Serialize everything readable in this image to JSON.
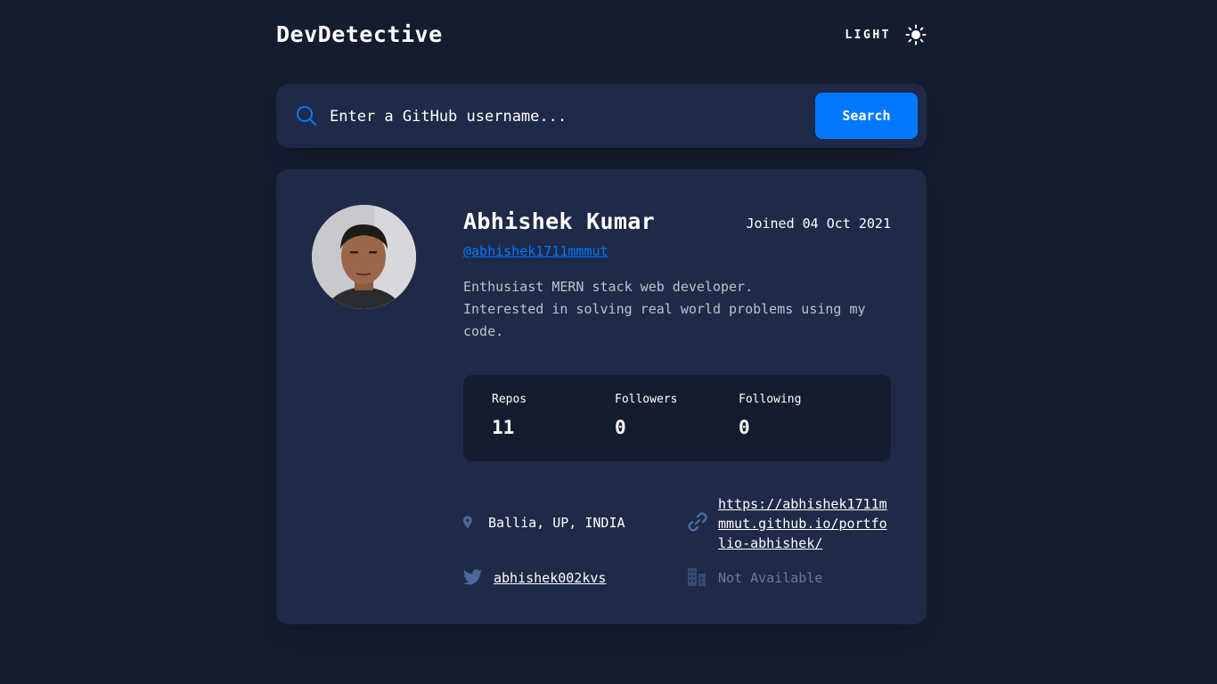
{
  "app": {
    "title": "DevDetective",
    "theme_label": "LIGHT",
    "theme_icon": "sun-icon"
  },
  "search": {
    "placeholder": "Enter a GitHub username...",
    "button_label": "Search",
    "icon": "search-icon"
  },
  "profile": {
    "name": "Abhishek Kumar",
    "joined": "Joined 04 Oct 2021",
    "username": "@abhishek1711mmmut",
    "bio_lines": [
      "Enthusiast MERN stack web developer.",
      "Interested in solving real world problems using my",
      "code."
    ],
    "stats": [
      {
        "label": "Repos",
        "value": "11"
      },
      {
        "label": "Followers",
        "value": "0"
      },
      {
        "label": "Following",
        "value": "0"
      }
    ],
    "links": {
      "location": {
        "icon": "location-pin-icon",
        "text": "Ballia, UP, INDIA"
      },
      "website": {
        "icon": "link-icon",
        "text": "https://abhishek1711mmmut.github.io/portfolio-abhishek/"
      },
      "twitter": {
        "icon": "twitter-icon",
        "text": "abhishek002kvs"
      },
      "company": {
        "icon": "building-icon",
        "text": "Not Available"
      }
    }
  },
  "colors": {
    "background": "#141d2f",
    "card": "#1e2a47",
    "accent": "#0079ff",
    "icon": "#4b6a9b"
  }
}
